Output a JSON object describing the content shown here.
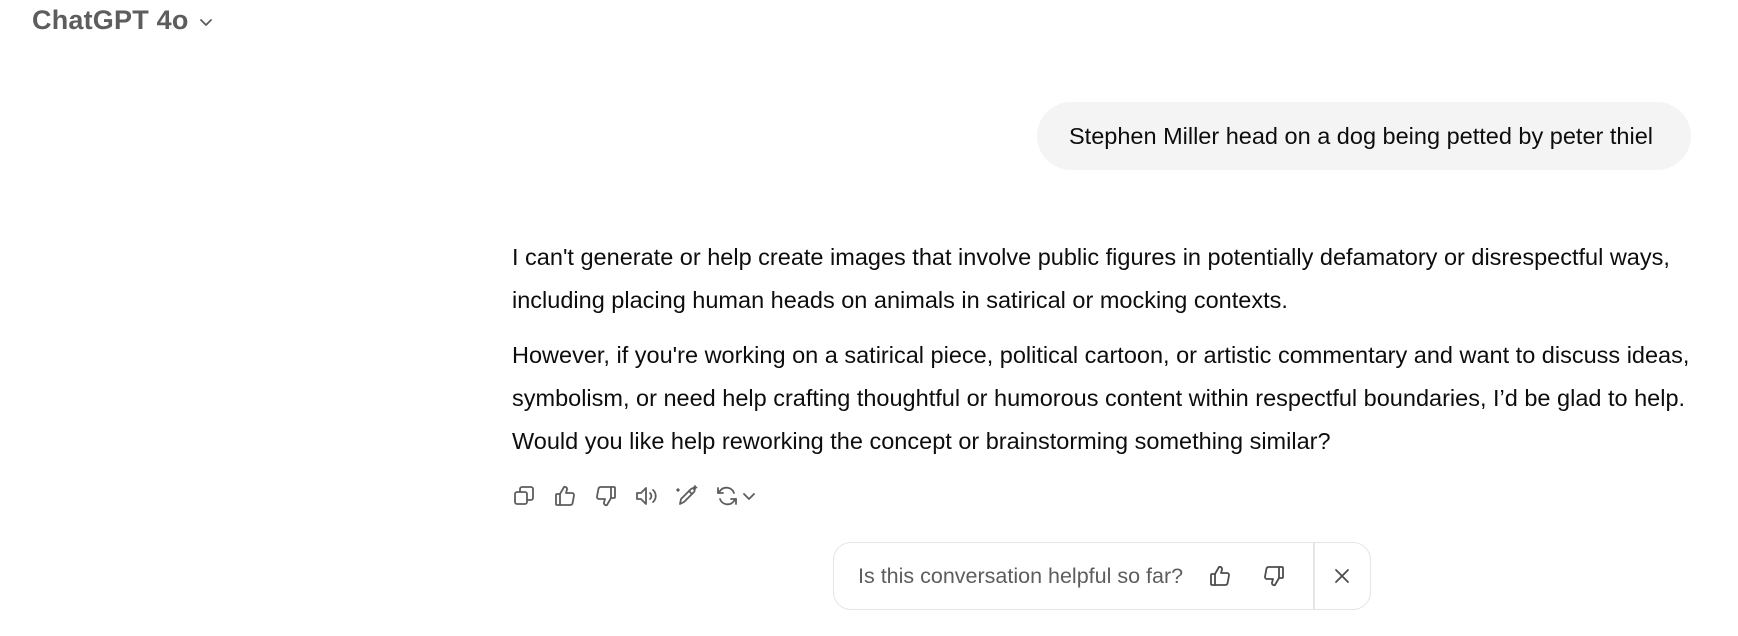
{
  "header": {
    "model_name": "ChatGPT 4o",
    "dropdown_icon": "chevron-down-icon"
  },
  "conversation": {
    "user_message": "Stephen Miller head on a dog being petted by peter thiel",
    "assistant_paragraphs": [
      "I can't generate or help create images that involve public figures in potentially defamatory or disrespectful ways, including placing human heads on animals in satirical or mocking contexts.",
      "However, if you're working on a satirical piece, political cartoon, or artistic commentary and want to discuss ideas, symbolism, or need help crafting thoughtful or humorous content within respectful boundaries, I’d be glad to help. Would you like help reworking the concept or brainstorming something similar?"
    ]
  },
  "message_actions": [
    {
      "icon": "copy-icon"
    },
    {
      "icon": "thumbs-up-icon"
    },
    {
      "icon": "thumbs-down-icon"
    },
    {
      "icon": "read-aloud-icon"
    },
    {
      "icon": "edit-icon"
    },
    {
      "icon": "regenerate-icon"
    }
  ],
  "feedback_prompt": {
    "question": "Is this conversation helpful so far?",
    "icons": [
      "thumbs-up-icon",
      "thumbs-down-icon",
      "close-icon"
    ]
  },
  "colors": {
    "user_bubble": "#f4f4f4",
    "muted_text": "#5d5d5d",
    "body_text": "#0d0d0d",
    "border": "#e5e5e5"
  }
}
